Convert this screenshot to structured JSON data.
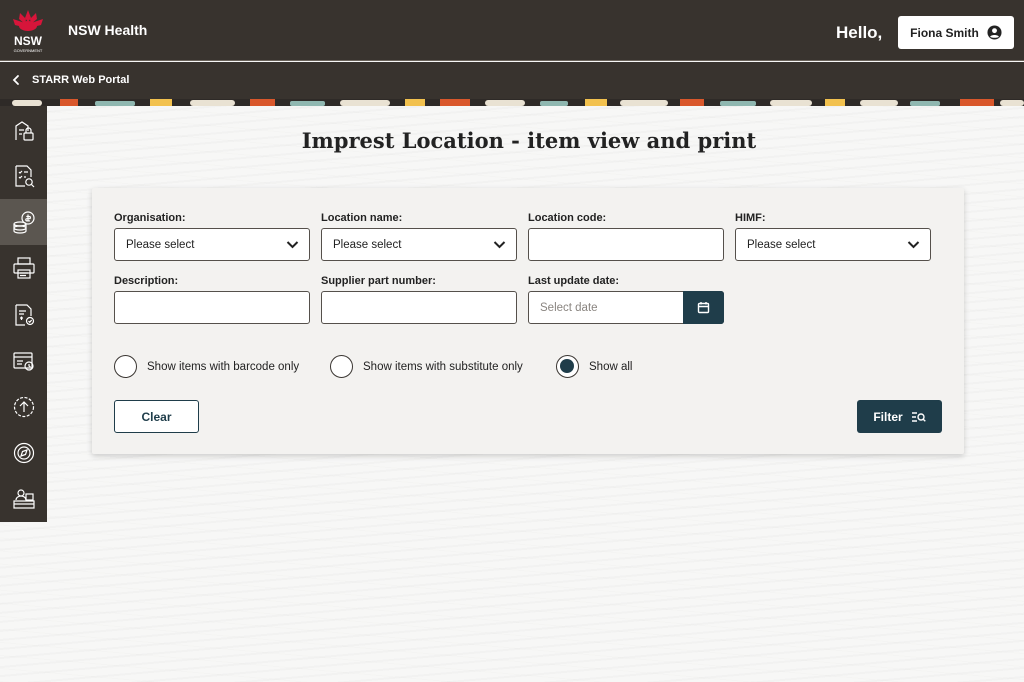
{
  "header": {
    "logo_text": "NSW",
    "logo_subtext": "GOVERNMENT",
    "brand": "NSW Health",
    "greeting": "Hello,",
    "user_name": "Fiona Smith"
  },
  "subheader": {
    "portal_title": "STARR Web Portal"
  },
  "sidebar": {
    "items": [
      {
        "icon": "security-lock-icon"
      },
      {
        "icon": "checklist-search-icon"
      },
      {
        "icon": "coins-icon",
        "active": true
      },
      {
        "icon": "printer-icon"
      },
      {
        "icon": "invoice-icon"
      },
      {
        "icon": "register-icon"
      },
      {
        "icon": "upload-circle-icon"
      },
      {
        "icon": "compass-icon"
      },
      {
        "icon": "stock-tray-icon"
      }
    ]
  },
  "main": {
    "title": "Imprest Location - item view and print"
  },
  "form": {
    "organisation": {
      "label": "Organisation:",
      "value": "Please select"
    },
    "location_name": {
      "label": "Location name:",
      "value": "Please select"
    },
    "location_code": {
      "label": "Location code:",
      "value": ""
    },
    "himf": {
      "label": "HIMF:",
      "value": "Please select"
    },
    "description": {
      "label": "Description:",
      "value": ""
    },
    "supplier_part_number": {
      "label": "Supplier part number:",
      "value": ""
    },
    "last_update_date": {
      "label": "Last update date:",
      "placeholder": "Select date"
    },
    "radios": [
      {
        "label": "Show items with barcode only",
        "checked": false
      },
      {
        "label": "Show items with substitute only",
        "checked": false
      },
      {
        "label": "Show all",
        "checked": true
      }
    ],
    "clear_label": "Clear",
    "filter_label": "Filter"
  },
  "colors": {
    "header_bg": "#38332e",
    "accent": "#1f3d4a",
    "logo_red": "#d7153a"
  }
}
